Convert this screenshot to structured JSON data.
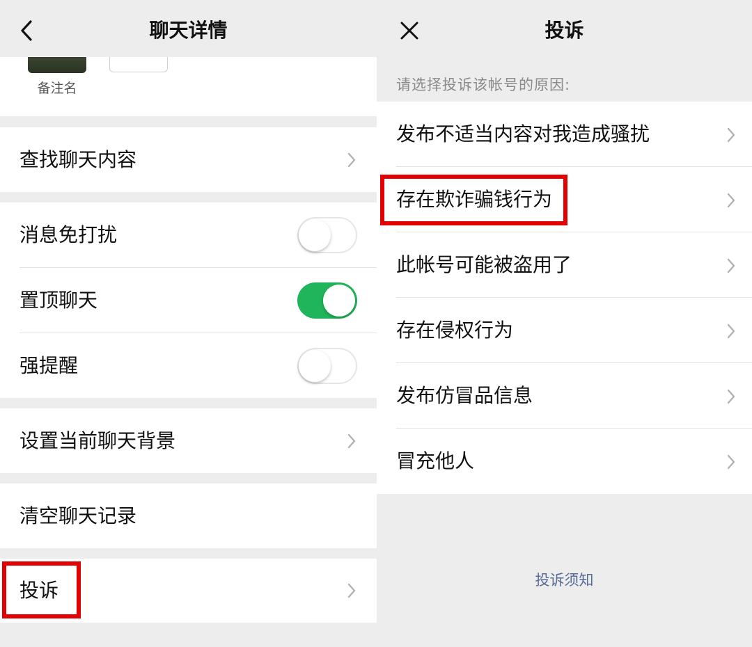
{
  "left": {
    "nav": {
      "title": "聊天详情",
      "back_icon": "chevron-left-icon"
    },
    "profile": {
      "avatar_name": "备注名"
    },
    "rows": {
      "search": {
        "label": "查找聊天内容"
      },
      "mute": {
        "label": "消息免打扰",
        "toggle": false
      },
      "pin": {
        "label": "置顶聊天",
        "toggle": true
      },
      "alert": {
        "label": "强提醒",
        "toggle": false
      },
      "background": {
        "label": "设置当前聊天背景"
      },
      "clear": {
        "label": "清空聊天记录"
      },
      "complain": {
        "label": "投诉",
        "highlighted": true
      }
    }
  },
  "right": {
    "nav": {
      "title": "投诉",
      "close_icon": "close-icon"
    },
    "prompt": "请选择投诉该帐号的原因:",
    "reasons": [
      {
        "label": "发布不适当内容对我造成骚扰"
      },
      {
        "label": "存在欺诈骗钱行为",
        "highlighted": true
      },
      {
        "label": "此帐号可能被盗用了"
      },
      {
        "label": "存在侵权行为"
      },
      {
        "label": "发布仿冒品信息"
      },
      {
        "label": "冒充他人"
      }
    ],
    "footer_link": "投诉须知"
  },
  "colors": {
    "accent_green": "#20b55a",
    "highlight_red": "#e30000",
    "link_blue": "#576b95",
    "background_gray": "#ededed"
  }
}
